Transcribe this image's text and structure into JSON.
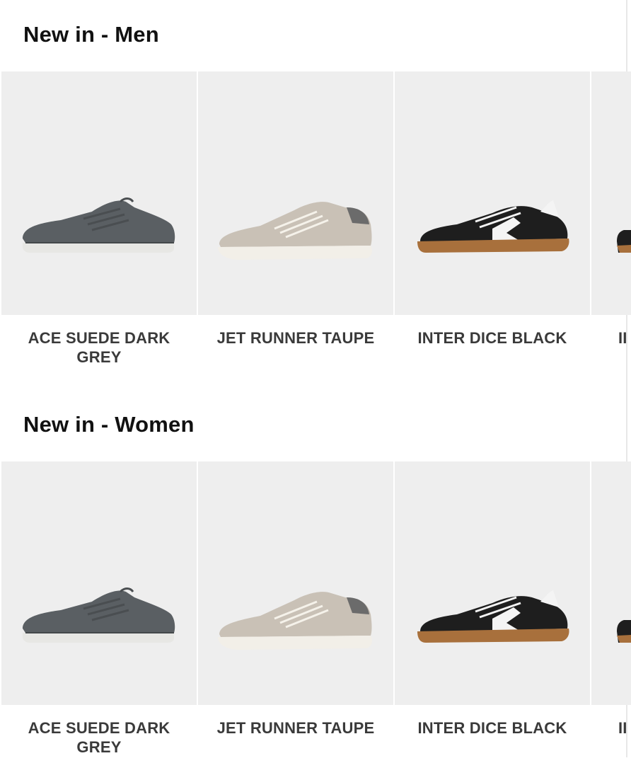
{
  "sections": [
    {
      "title": "New in - Men",
      "products": [
        {
          "name": "ACE SUEDE DARK GREY",
          "image": "shoe-ace-suede-dark-grey"
        },
        {
          "name": "JET RUNNER TAUPE",
          "image": "shoe-jet-runner-taupe"
        },
        {
          "name": "INTER DICE BLACK",
          "image": "shoe-inter-dice-black"
        },
        {
          "name": "II",
          "image": "shoe-partial"
        }
      ]
    },
    {
      "title": "New in - Women",
      "products": [
        {
          "name": "ACE SUEDE DARK GREY",
          "image": "shoe-ace-suede-dark-grey"
        },
        {
          "name": "JET RUNNER TAUPE",
          "image": "shoe-jet-runner-taupe"
        },
        {
          "name": "INTER DICE BLACK",
          "image": "shoe-inter-dice-black"
        },
        {
          "name": "II",
          "image": "shoe-partial"
        }
      ]
    }
  ],
  "colors": {
    "card_background": "#eeeeee",
    "title_text": "#111111",
    "product_text": "#3a3a3a"
  }
}
